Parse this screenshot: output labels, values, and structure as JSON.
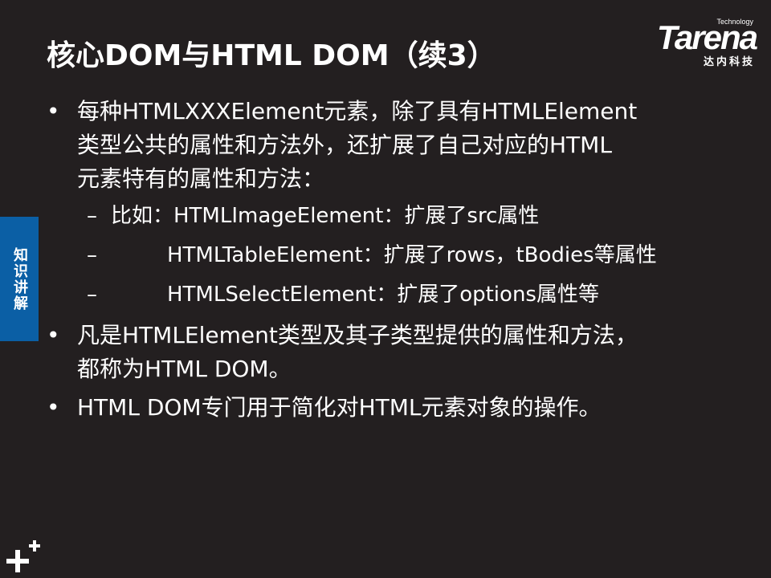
{
  "slide": {
    "title": "核心DOM与HTML DOM（续3）",
    "logo": {
      "tech": "Technology",
      "word": "Tarena",
      "cn": "达内科技"
    },
    "side_tab": "知识讲解",
    "bullets": [
      {
        "lines": [
          "每种HTMLXXXElement元素，除了具有HTMLElement",
          "类型公共的属性和方法外，还扩展了自己对应的HTML",
          "元素特有的属性和方法："
        ]
      },
      {
        "lines": [
          "凡是HTMLElement类型及其子类型提供的属性和方法，",
          "都称为HTML DOM。"
        ]
      },
      {
        "lines": [
          "HTML DOM专门用于简化对HTML元素对象的操作。"
        ]
      }
    ],
    "sub_items": [
      {
        "dash": "–",
        "text": "比如：HTMLImageElement：扩展了src属性"
      },
      {
        "dash": "–",
        "text": "HTMLTableElement：扩展了rows，tBodies等属性"
      },
      {
        "dash": "–",
        "text": "HTMLSelectElement：扩展了options属性等"
      }
    ],
    "colors": {
      "background": "#231f20",
      "text": "#ffffff",
      "side_tab": "#0b5fa5"
    },
    "icons": [
      "plus-icon"
    ]
  }
}
